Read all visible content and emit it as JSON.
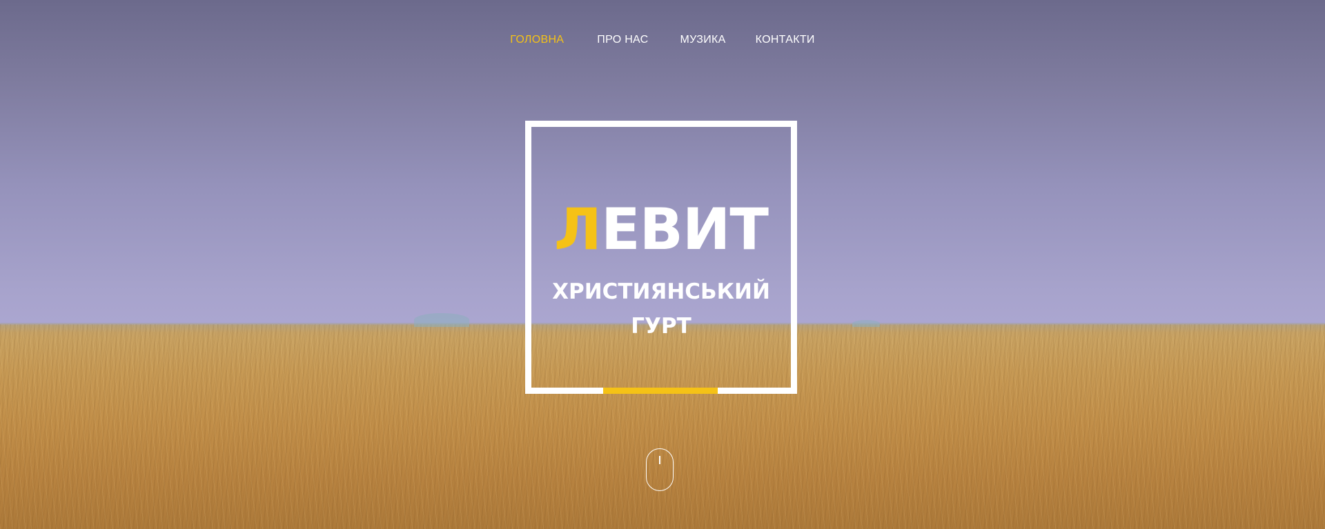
{
  "nav": {
    "items": [
      {
        "label": "ГОЛОВНА",
        "active": true
      },
      {
        "label": "ПРО НАС",
        "active": false
      },
      {
        "label": "МУЗИКА",
        "active": false
      },
      {
        "label": "КОНТАКТИ",
        "active": false
      }
    ]
  },
  "hero": {
    "title_first_letter": "Л",
    "title_rest": "ЕВИТ",
    "subtitle_line1": "ХРИСТИЯНСЬКИЙ",
    "subtitle_line2": "ГУРТ",
    "scroll_icon": "mouse-scroll-icon"
  },
  "colors": {
    "accent": "#f5c216",
    "text": "#ffffff"
  }
}
